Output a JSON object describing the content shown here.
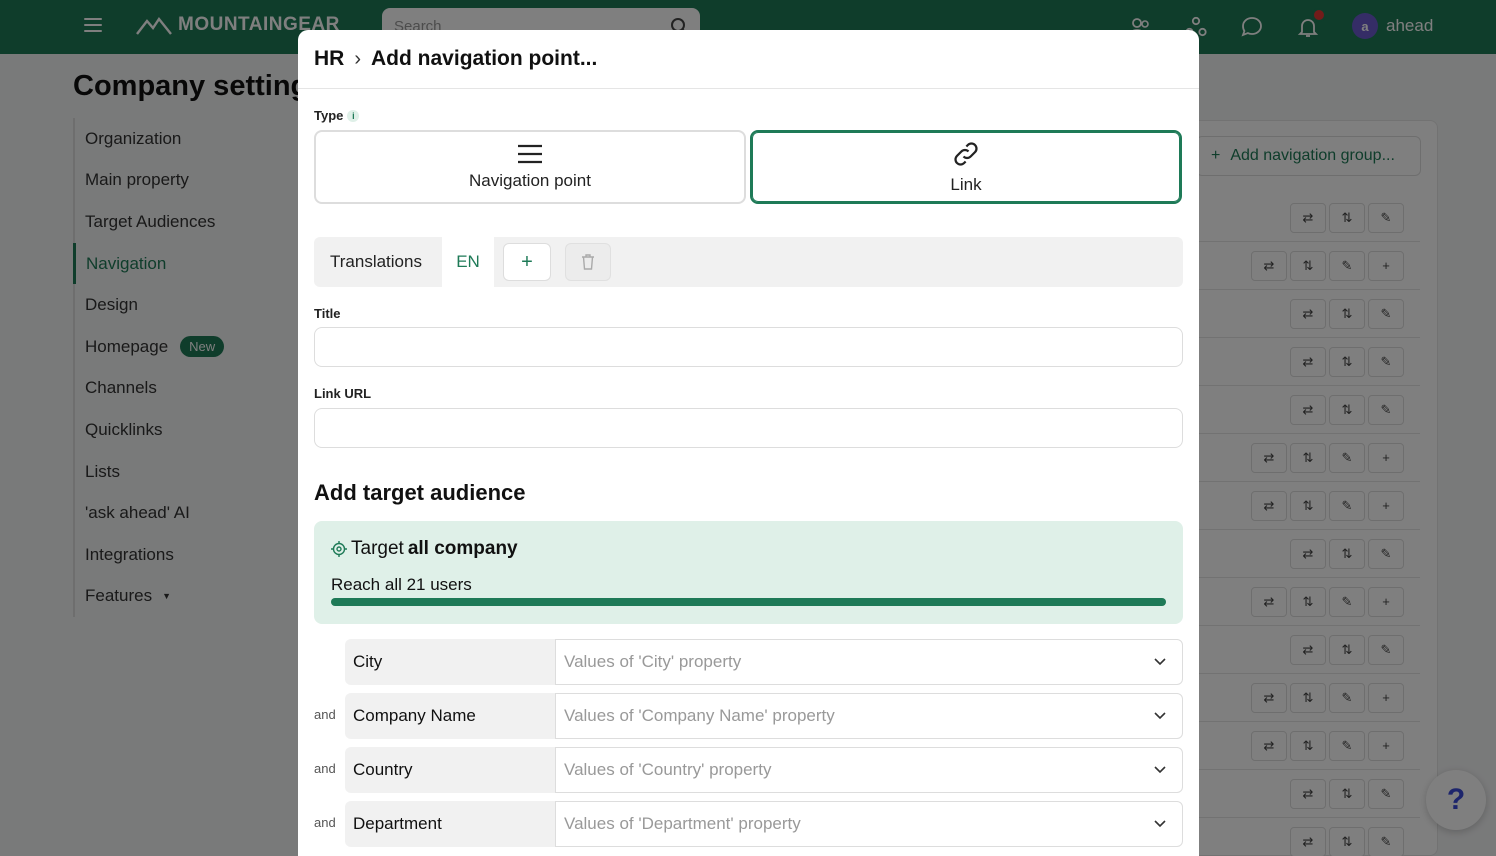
{
  "topbar": {
    "brand": "MOUNTAINGEAR",
    "search_placeholder": "Search",
    "user_name": "ahead",
    "avatar_letter": "a"
  },
  "page": {
    "title": "Company settings",
    "nav": [
      {
        "label": "Organization"
      },
      {
        "label": "Main property"
      },
      {
        "label": "Target Audiences"
      },
      {
        "label": "Navigation"
      },
      {
        "label": "Design"
      },
      {
        "label": "Homepage",
        "badge": "New"
      },
      {
        "label": "Channels"
      },
      {
        "label": "Quicklinks"
      },
      {
        "label": "Lists"
      },
      {
        "label": "'ask ahead' AI"
      },
      {
        "label": "Integrations"
      },
      {
        "label": "Features"
      }
    ],
    "add_group_label": "Add navigation group...",
    "help_label": "?"
  },
  "modal": {
    "breadcrumb_parent": "HR",
    "title": "Add navigation point...",
    "type_label": "Type",
    "type_options": [
      {
        "label": "Navigation point",
        "icon": "menu-icon"
      },
      {
        "label": "Link",
        "icon": "link-icon",
        "selected": true
      }
    ],
    "translations_label": "Translations",
    "language_tab": "EN",
    "add_language": "+",
    "title_label": "Title",
    "title_value": "",
    "link_url_label": "Link URL",
    "link_url_value": "",
    "target_section_title": "Add target audience",
    "target": {
      "prefix": "Target",
      "scope": "all company",
      "reach_text": "Reach all 21 users",
      "reach_fraction": 1.0
    },
    "filters": [
      {
        "conj": "",
        "property": "City",
        "placeholder": "Values of 'City' property"
      },
      {
        "conj": "and",
        "property": "Company Name",
        "placeholder": "Values of 'Company Name' property"
      },
      {
        "conj": "and",
        "property": "Country",
        "placeholder": "Values of 'Country' property"
      },
      {
        "conj": "and",
        "property": "Department",
        "placeholder": "Values of 'Department' property"
      }
    ]
  },
  "colors": {
    "brand": "#1e7a57",
    "target_bg": "#dff0e8",
    "notification": "#e53935"
  }
}
